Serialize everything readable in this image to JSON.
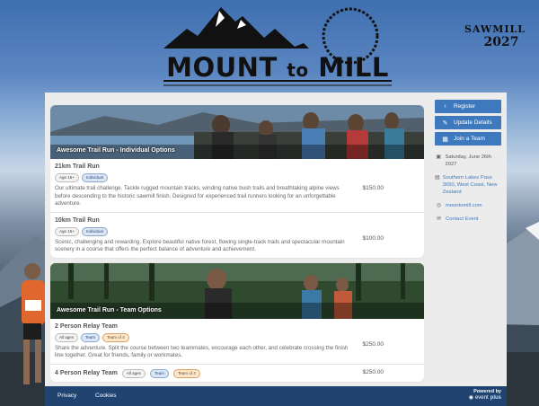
{
  "brand": {
    "title_main": "MOUNT",
    "title_to": "to",
    "title_end": "MILL",
    "sawmill": "SAWMILL",
    "year": "2027"
  },
  "sections": [
    {
      "title": "Awesome Trail Run - Individual Options",
      "options": [
        {
          "name": "21km Trail Run",
          "badges": [
            "Age 15+",
            "Individual"
          ],
          "description": "Our ultimate trail challenge. Tackle rugged mountain tracks, winding native bush trails and breathtaking alpine views before descending to the historic sawmill finish. Designed for experienced trail runners looking for an unforgettable adventure.",
          "price": "$150.00"
        },
        {
          "name": "10km Trail Run",
          "badges": [
            "Age 15+",
            "Individual"
          ],
          "description": "Scenic, challenging and rewarding. Explore beautiful native forest, flowing single-track trails and spectacular mountain scenery in a course that offers the perfect balance of adventure and achievement.",
          "price": "$100.00"
        }
      ]
    },
    {
      "title": "Awesome Trail Run - Team Options",
      "options": [
        {
          "name": "2 Person Relay Team",
          "badges": [
            "All ages",
            "Team",
            "Team of 4"
          ],
          "description": "Share the adventure. Split the course between two teammates, encourage each other, and celebrate crossing the finish line together. Great for friends, family or workmates.",
          "price": "$250.00"
        },
        {
          "name": "4 Person Relay Team",
          "badges": [
            "All ages",
            "Team",
            "Team of 4"
          ],
          "price": "$250.00"
        }
      ]
    }
  ],
  "sidebar": {
    "buttons": [
      {
        "label": "Register",
        "icon": "chevron-right-icon"
      },
      {
        "label": "Update Details",
        "icon": "pencil-icon"
      },
      {
        "label": "Join a Team",
        "icon": "team-icon"
      }
    ],
    "date": "Saturday, June 26th 2027",
    "location": "Southern Lakes Pass 3650, West Coast, New Zealand",
    "website": "mountomill.com",
    "contact": "Contact Event"
  },
  "footer": {
    "privacy": "Privacy",
    "cookies": "Cookies",
    "powered_by": "Powered by",
    "brand_a": "event",
    "brand_b": "plus"
  },
  "colors": {
    "accent": "#3f79bd",
    "footer": "#20436f"
  }
}
